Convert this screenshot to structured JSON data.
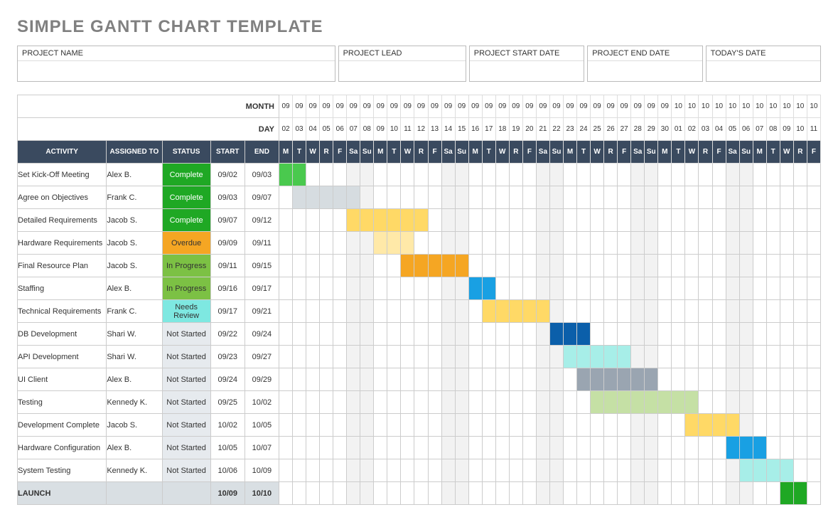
{
  "title": "SIMPLE GANTT CHART TEMPLATE",
  "meta": {
    "projectName": "PROJECT NAME",
    "projectLead": "PROJECT LEAD",
    "startDate": "PROJECT START DATE",
    "endDate": "PROJECT END DATE",
    "today": "TODAY'S DATE"
  },
  "hdr": {
    "month": "MONTH",
    "day": "DAY",
    "activity": "ACTIVITY",
    "assigned": "ASSIGNED TO",
    "status": "STATUS",
    "start": "START",
    "end": "END"
  },
  "days": [
    {
      "m": "09",
      "d": "02",
      "w": "M"
    },
    {
      "m": "09",
      "d": "03",
      "w": "T"
    },
    {
      "m": "09",
      "d": "04",
      "w": "W"
    },
    {
      "m": "09",
      "d": "05",
      "w": "R"
    },
    {
      "m": "09",
      "d": "06",
      "w": "F"
    },
    {
      "m": "09",
      "d": "07",
      "w": "Sa"
    },
    {
      "m": "09",
      "d": "08",
      "w": "Su"
    },
    {
      "m": "09",
      "d": "09",
      "w": "M"
    },
    {
      "m": "09",
      "d": "10",
      "w": "T"
    },
    {
      "m": "09",
      "d": "11",
      "w": "W"
    },
    {
      "m": "09",
      "d": "12",
      "w": "R"
    },
    {
      "m": "09",
      "d": "13",
      "w": "F"
    },
    {
      "m": "09",
      "d": "14",
      "w": "Sa"
    },
    {
      "m": "09",
      "d": "15",
      "w": "Su"
    },
    {
      "m": "09",
      "d": "16",
      "w": "M"
    },
    {
      "m": "09",
      "d": "17",
      "w": "T"
    },
    {
      "m": "09",
      "d": "18",
      "w": "W"
    },
    {
      "m": "09",
      "d": "19",
      "w": "R"
    },
    {
      "m": "09",
      "d": "20",
      "w": "F"
    },
    {
      "m": "09",
      "d": "21",
      "w": "Sa"
    },
    {
      "m": "09",
      "d": "22",
      "w": "Su"
    },
    {
      "m": "09",
      "d": "23",
      "w": "M"
    },
    {
      "m": "09",
      "d": "24",
      "w": "T"
    },
    {
      "m": "09",
      "d": "25",
      "w": "W"
    },
    {
      "m": "09",
      "d": "26",
      "w": "R"
    },
    {
      "m": "09",
      "d": "27",
      "w": "F"
    },
    {
      "m": "09",
      "d": "28",
      "w": "Sa"
    },
    {
      "m": "09",
      "d": "29",
      "w": "Su"
    },
    {
      "m": "09",
      "d": "30",
      "w": "M"
    },
    {
      "m": "10",
      "d": "01",
      "w": "T"
    },
    {
      "m": "10",
      "d": "02",
      "w": "W"
    },
    {
      "m": "10",
      "d": "03",
      "w": "R"
    },
    {
      "m": "10",
      "d": "04",
      "w": "F"
    },
    {
      "m": "10",
      "d": "05",
      "w": "Sa"
    },
    {
      "m": "10",
      "d": "06",
      "w": "Su"
    },
    {
      "m": "10",
      "d": "07",
      "w": "M"
    },
    {
      "m": "10",
      "d": "08",
      "w": "T"
    },
    {
      "m": "10",
      "d": "09",
      "w": "W"
    },
    {
      "m": "10",
      "d": "10",
      "w": "R"
    },
    {
      "m": "10",
      "d": "11",
      "w": "F"
    }
  ],
  "rows": [
    {
      "activity": "Set Kick-Off Meeting",
      "assigned": "Alex B.",
      "status": "Complete",
      "statusClass": "Complete",
      "start": "09/02",
      "end": "09/03",
      "bar": [
        0,
        1
      ],
      "barClass": "bar-green"
    },
    {
      "activity": "Agree on Objectives",
      "assigned": "Frank C.",
      "status": "Complete",
      "statusClass": "Complete",
      "start": "09/03",
      "end": "09/07",
      "bar": [
        1,
        5
      ],
      "barClass": "bar-grey"
    },
    {
      "activity": "Detailed Requirements",
      "assigned": "Jacob S.",
      "status": "Complete",
      "statusClass": "Complete",
      "start": "09/07",
      "end": "09/12",
      "bar": [
        5,
        10
      ],
      "barClass": "bar-yellow"
    },
    {
      "activity": "Hardware Requirements",
      "assigned": "Jacob S.",
      "status": "Overdue",
      "statusClass": "Overdue",
      "start": "09/09",
      "end": "09/11",
      "bar": [
        7,
        9
      ],
      "barClass": "bar-ylight"
    },
    {
      "activity": "Final Resource Plan",
      "assigned": "Jacob S.",
      "status": "In Progress",
      "statusClass": "InProgress",
      "start": "09/11",
      "end": "09/15",
      "bar": [
        9,
        13
      ],
      "barClass": "bar-orange"
    },
    {
      "activity": "Staffing",
      "assigned": "Alex B.",
      "status": "In Progress",
      "statusClass": "InProgress",
      "start": "09/16",
      "end": "09/17",
      "bar": [
        14,
        15
      ],
      "barClass": "bar-blue"
    },
    {
      "activity": "Technical Requirements",
      "assigned": "Frank C.",
      "status": "Needs Review",
      "statusClass": "NeedsReview",
      "start": "09/17",
      "end": "09/21",
      "bar": [
        15,
        19
      ],
      "barClass": "bar-yellow"
    },
    {
      "activity": "DB Development",
      "assigned": "Shari W.",
      "status": "Not Started",
      "statusClass": "NotStarted",
      "start": "09/22",
      "end": "09/24",
      "bar": [
        20,
        22
      ],
      "barClass": "bar-dblue"
    },
    {
      "activity": "API Development",
      "assigned": "Shari W.",
      "status": "Not Started",
      "statusClass": "NotStarted",
      "start": "09/23",
      "end": "09/27",
      "bar": [
        21,
        25
      ],
      "barClass": "bar-cyan"
    },
    {
      "activity": "UI Client",
      "assigned": "Alex B.",
      "status": "Not Started",
      "statusClass": "NotStarted",
      "start": "09/24",
      "end": "09/29",
      "bar": [
        22,
        27
      ],
      "barClass": "bar-slate"
    },
    {
      "activity": "Testing",
      "assigned": "Kennedy K.",
      "status": "Not Started",
      "statusClass": "NotStarted",
      "start": "09/25",
      "end": "10/02",
      "bar": [
        23,
        30
      ],
      "barClass": "bar-lime"
    },
    {
      "activity": "Development Complete",
      "assigned": "Jacob S.",
      "status": "Not Started",
      "statusClass": "NotStarted",
      "start": "10/02",
      "end": "10/05",
      "bar": [
        30,
        33
      ],
      "barClass": "bar-yellow"
    },
    {
      "activity": "Hardware Configuration",
      "assigned": "Alex B.",
      "status": "Not Started",
      "statusClass": "NotStarted",
      "start": "10/05",
      "end": "10/07",
      "bar": [
        33,
        35
      ],
      "barClass": "bar-blue"
    },
    {
      "activity": "System Testing",
      "assigned": "Kennedy K.",
      "status": "Not Started",
      "statusClass": "NotStarted",
      "start": "10/06",
      "end": "10/09",
      "bar": [
        34,
        37
      ],
      "barClass": "bar-cyan"
    },
    {
      "activity": "LAUNCH",
      "assigned": "",
      "status": "",
      "statusClass": "",
      "start": "10/09",
      "end": "10/10",
      "bar": [
        37,
        38
      ],
      "barClass": "bar-emer",
      "rowClass": "launch"
    }
  ],
  "chart_data": {
    "type": "gantt",
    "title": "Simple Gantt Chart Template",
    "date_range": [
      "09/02",
      "10/11"
    ],
    "tasks": [
      {
        "name": "Set Kick-Off Meeting",
        "owner": "Alex B.",
        "status": "Complete",
        "start": "09/02",
        "end": "09/03"
      },
      {
        "name": "Agree on Objectives",
        "owner": "Frank C.",
        "status": "Complete",
        "start": "09/03",
        "end": "09/07"
      },
      {
        "name": "Detailed Requirements",
        "owner": "Jacob S.",
        "status": "Complete",
        "start": "09/07",
        "end": "09/12"
      },
      {
        "name": "Hardware Requirements",
        "owner": "Jacob S.",
        "status": "Overdue",
        "start": "09/09",
        "end": "09/11"
      },
      {
        "name": "Final Resource Plan",
        "owner": "Jacob S.",
        "status": "In Progress",
        "start": "09/11",
        "end": "09/15"
      },
      {
        "name": "Staffing",
        "owner": "Alex B.",
        "status": "In Progress",
        "start": "09/16",
        "end": "09/17"
      },
      {
        "name": "Technical Requirements",
        "owner": "Frank C.",
        "status": "Needs Review",
        "start": "09/17",
        "end": "09/21"
      },
      {
        "name": "DB Development",
        "owner": "Shari W.",
        "status": "Not Started",
        "start": "09/22",
        "end": "09/24"
      },
      {
        "name": "API Development",
        "owner": "Shari W.",
        "status": "Not Started",
        "start": "09/23",
        "end": "09/27"
      },
      {
        "name": "UI Client",
        "owner": "Alex B.",
        "status": "Not Started",
        "start": "09/24",
        "end": "09/29"
      },
      {
        "name": "Testing",
        "owner": "Kennedy K.",
        "status": "Not Started",
        "start": "09/25",
        "end": "10/02"
      },
      {
        "name": "Development Complete",
        "owner": "Jacob S.",
        "status": "Not Started",
        "start": "10/02",
        "end": "10/05"
      },
      {
        "name": "Hardware Configuration",
        "owner": "Alex B.",
        "status": "Not Started",
        "start": "10/05",
        "end": "10/07"
      },
      {
        "name": "System Testing",
        "owner": "Kennedy K.",
        "status": "Not Started",
        "start": "10/06",
        "end": "10/09"
      },
      {
        "name": "LAUNCH",
        "owner": "",
        "status": "",
        "start": "10/09",
        "end": "10/10"
      }
    ]
  }
}
